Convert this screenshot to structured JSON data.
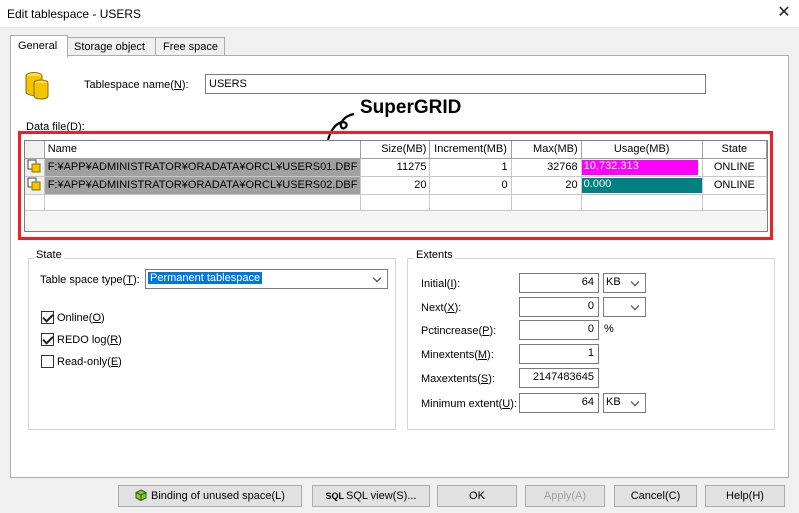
{
  "window": {
    "title": "Edit tablespace - USERS",
    "close_glyph": "✕"
  },
  "tabs": [
    {
      "label": "General",
      "active": true
    },
    {
      "label": "Storage object",
      "active": false
    },
    {
      "label": "Free space",
      "active": false
    }
  ],
  "tablespace": {
    "label_pre": "Tablespace name(",
    "label_key": "N",
    "label_post": "):",
    "value": "USERS"
  },
  "annotation": {
    "text": "SuperGRID"
  },
  "datafile": {
    "label_pre": "Data file(",
    "label_key": "D",
    "label_post": "):",
    "columns": [
      "Name",
      "Size(MB)",
      "Increment(MB)",
      "Max(MB)",
      "Usage(MB)",
      "State"
    ],
    "rows": [
      {
        "name": "F:¥APP¥ADMINISTRATOR¥ORADATA¥ORCL¥USERS01.DBF",
        "size": "11275",
        "increment": "1",
        "max": "32768",
        "usage": "10,732.313",
        "state": "ONLINE",
        "usage_color": "#ff00ff"
      },
      {
        "name": "F:¥APP¥ADMINISTRATOR¥ORADATA¥ORCL¥USERS02.DBF",
        "size": "20",
        "increment": "0",
        "max": "20",
        "usage": "0.000",
        "state": "ONLINE",
        "usage_color": "#008080"
      }
    ]
  },
  "state": {
    "title": "State",
    "type_label_pre": "Table space type(",
    "type_label_key": "T",
    "type_label_post": "):",
    "type_value": "Permanent tablespace",
    "checkboxes": [
      {
        "label_pre": "Online(",
        "label_key": "O",
        "label_post": ")",
        "checked": true
      },
      {
        "label_pre": "REDO log(",
        "label_key": "R",
        "label_post": ")",
        "checked": true
      },
      {
        "label_pre": "Read-only(",
        "label_key": "E",
        "label_post": ")",
        "checked": false
      }
    ]
  },
  "extents": {
    "title": "Extents",
    "initial": {
      "label_pre": "Initial(",
      "label_key": "I",
      "label_post": "):",
      "value": "64",
      "unit": "KB"
    },
    "next": {
      "label_pre": "Next(",
      "label_key": "X",
      "label_post": "):",
      "value": "0",
      "unit": ""
    },
    "pctincrease": {
      "label_pre": "Pctincrease(",
      "label_key": "P",
      "label_post": "):",
      "value": "0",
      "unit": "%"
    },
    "minextents": {
      "label_pre": "Minextents(",
      "label_key": "M",
      "label_post": "):",
      "value": "1"
    },
    "maxextents": {
      "label_pre": "Maxextents(",
      "label_key": "S",
      "label_post": "):",
      "value": "2147483645"
    },
    "minimum_extent": {
      "label_pre": "Minimum extent(",
      "label_key": "U",
      "label_post": "):",
      "value": "64",
      "unit": "KB"
    }
  },
  "buttons": {
    "binding": "Binding of unused space(L)",
    "sqlview_prefix": "SQL",
    "sqlview": "SQL view(S)...",
    "ok": "OK",
    "apply": "Apply(A)",
    "cancel": "Cancel(C)",
    "help": "Help(H)"
  }
}
